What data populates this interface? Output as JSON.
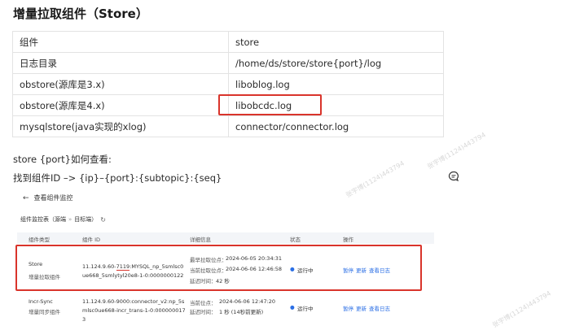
{
  "title": "增量拉取组件（Store）",
  "table": [
    [
      "组件",
      "store"
    ],
    [
      "日志目录",
      "/home/ds/store/store{port}/log"
    ],
    [
      "obstore(源库是3.x)",
      "liboblog.log"
    ],
    [
      "obstore(源库是4.x)",
      "libobcdc.log"
    ],
    [
      "mysqlstore(java实现的xlog)",
      "connector/connector.log"
    ]
  ],
  "para1": "store {port}如何查看:",
  "para2": "找到组件ID –> {ip}–{port}:{subtopic}:{seq}",
  "watermark_text": "张宇博(1124)443794",
  "screenshot": {
    "back_label": "查看组件监控",
    "breadcrumb": [
      "组件监控表（源端",
      "目标端）"
    ],
    "columns": [
      "组件类型",
      "组件 ID",
      "详细信息",
      "状态",
      "操作"
    ],
    "rows": [
      {
        "type": "Store",
        "type_sub": "增量拉取组件",
        "id_line1_prefix": "11.124.9.60-",
        "id_line1_port": "7119",
        "id_line1_suffix": ":MYSQL_np_5smlsc0",
        "id_line2": "ue668_5smlytyl20e8-1-0:0000000122",
        "detail1_label": "最早拉取位点：",
        "detail1_value": "2024-06-05 20:34:31",
        "detail2_label": "当前拉取位点：",
        "detail2_value": "2024-06-06 12:46:58",
        "detail3_label": "延迟时间：",
        "detail3_value": "42 秒",
        "status": "运行中",
        "ops": [
          "暂停",
          "更新",
          "查看日志"
        ]
      },
      {
        "type": "Incr-Sync",
        "type_sub": "增量同步组件",
        "id_line1": "11.124.9.60-9000:connector_v2:np_5s",
        "id_line2": "mlsc0ue668-incr_trans-1-0:000000017",
        "id_line3": "3",
        "detail1_label": "当前位点：",
        "detail1_value": "2024-06-06 12:47:20",
        "detail2_label": "延迟时间：",
        "detail2_value": "1 秒 (14秒前更新)",
        "status": "运行中",
        "ops": [
          "暂停",
          "更新",
          "查看日志"
        ]
      }
    ]
  },
  "colors": {
    "highlight": "#d9342b",
    "link": "#2b6fe5"
  }
}
